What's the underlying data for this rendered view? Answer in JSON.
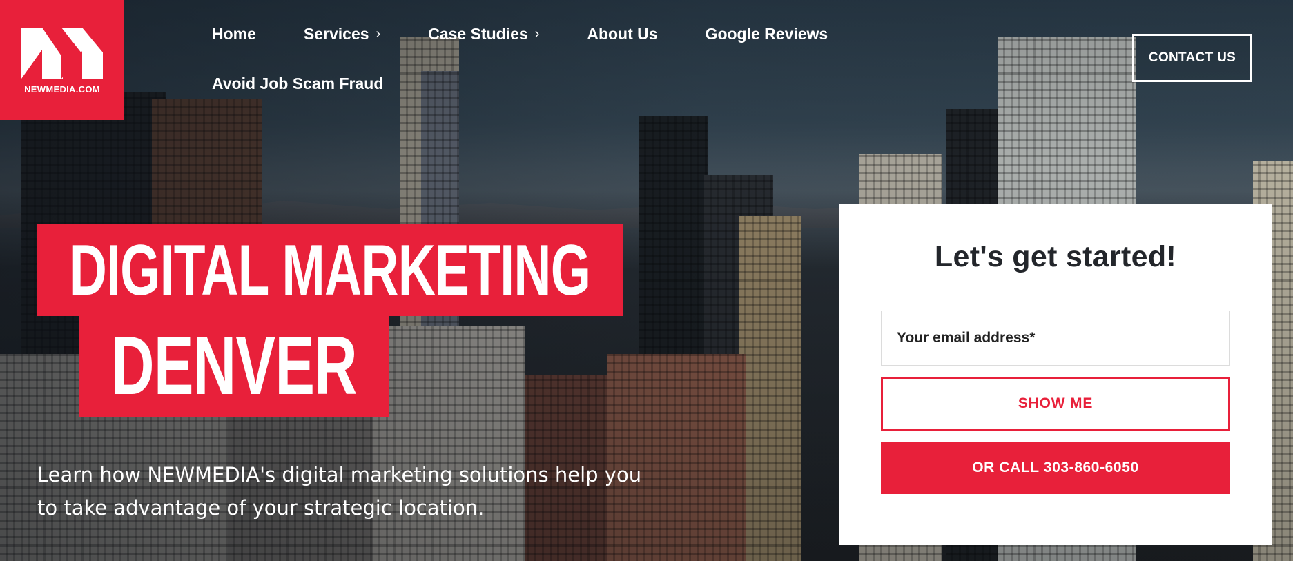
{
  "logo": {
    "text": "NEWMEDIA.COM"
  },
  "nav": {
    "row1": [
      {
        "label": "Home",
        "has_submenu": false
      },
      {
        "label": "Services",
        "has_submenu": true
      },
      {
        "label": "Case Studies",
        "has_submenu": true
      },
      {
        "label": "About Us",
        "has_submenu": false
      },
      {
        "label": "Google Reviews",
        "has_submenu": false
      }
    ],
    "row2": [
      {
        "label": "Avoid Job Scam Fraud",
        "has_submenu": false
      }
    ],
    "chevron": "›"
  },
  "contact_button": {
    "label": "CONTACT US"
  },
  "hero": {
    "line1": "DIGITAL MARKETING",
    "line2": "DENVER",
    "subtitle_line1": "Learn how NEWMEDIA's digital marketing solutions help you",
    "subtitle_line2": "to take advantage of your strategic location."
  },
  "form": {
    "title": "Let's get started!",
    "email_placeholder": "Your email address*",
    "email_value": "",
    "show_me_label": "SHOW ME",
    "call_label": "OR CALL 303-860-6050"
  },
  "colors": {
    "brand_red": "#e8203a",
    "white": "#ffffff",
    "dark_text": "#23262b"
  },
  "icons": {
    "logo_mark": "newmedia-logo-icon",
    "submenu": "chevron-right-icon"
  }
}
